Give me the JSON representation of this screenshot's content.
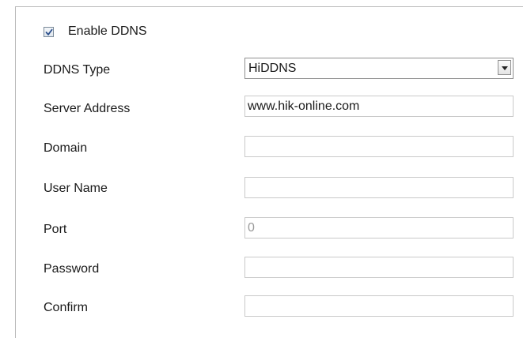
{
  "enable_ddns": {
    "label": "Enable DDNS",
    "checked": true
  },
  "fields": {
    "ddns_type": {
      "label": "DDNS Type",
      "value": "HiDDNS",
      "icon": "chevron-down-icon"
    },
    "server_address": {
      "label": "Server Address",
      "value": "www.hik-online.com"
    },
    "domain": {
      "label": "Domain",
      "value": ""
    },
    "user_name": {
      "label": "User Name",
      "value": ""
    },
    "port": {
      "label": "Port",
      "value": "0"
    },
    "password": {
      "label": "Password",
      "value": ""
    },
    "confirm": {
      "label": "Confirm",
      "value": ""
    }
  }
}
